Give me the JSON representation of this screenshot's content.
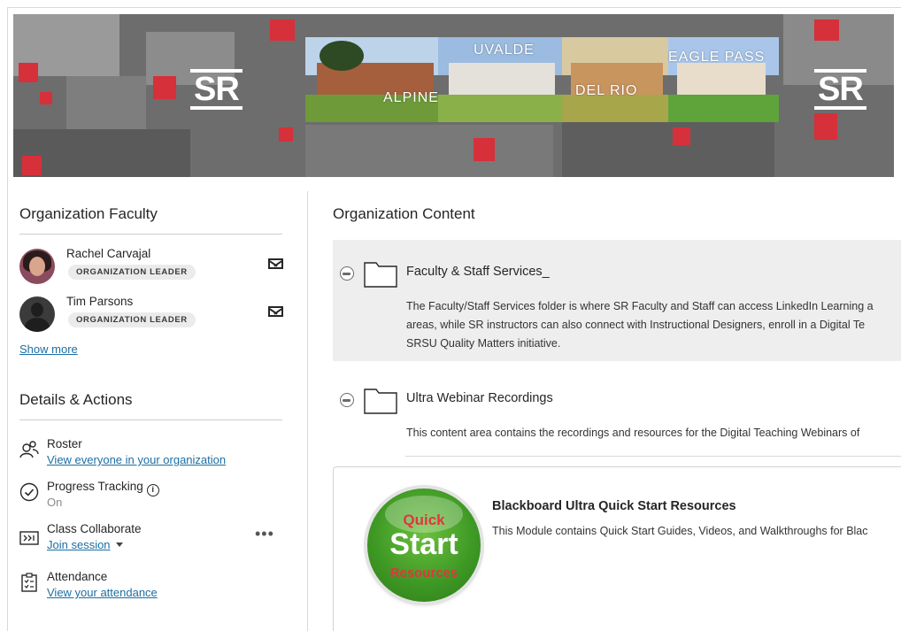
{
  "banner": {
    "logo_left": "SR",
    "logo_right": "SR",
    "campuses": [
      "ALPINE",
      "UVALDE",
      "DEL RIO",
      "EAGLE PASS"
    ],
    "accent": "#d6303a"
  },
  "faculty": {
    "title": "Organization Faculty",
    "members": [
      {
        "name": "Rachel Carvajal",
        "role": "ORGANIZATION LEADER"
      },
      {
        "name": "Tim Parsons",
        "role": "ORGANIZATION LEADER"
      }
    ],
    "show_more": "Show more"
  },
  "details": {
    "title": "Details & Actions",
    "items": [
      {
        "icon": "roster-icon",
        "title": "Roster",
        "sub": "View everyone in your organization"
      },
      {
        "icon": "progress-check-icon",
        "title": "Progress Tracking",
        "sub": "On",
        "info": "i"
      },
      {
        "icon": "collaborate-icon",
        "title": "Class Collaborate",
        "sub": "Join session",
        "more": "•••"
      },
      {
        "icon": "attendance-icon",
        "title": "Attendance",
        "sub": "View your attendance"
      }
    ]
  },
  "content": {
    "title": "Organization Content",
    "items": [
      {
        "title": "Faculty & Staff Services_",
        "desc": [
          "The Faculty/Staff Services folder is where SR Faculty and Staff can access LinkedIn Learning a",
          "areas, while SR instructors can also connect with Instructional Designers, enroll in a Digital Te",
          "SRSU Quality Matters initiative."
        ]
      },
      {
        "title": "Ultra Webinar Recordings",
        "desc": [
          "This content area contains the recordings and resources for the Digital Teaching Webinars of"
        ]
      }
    ],
    "module": {
      "badge_top": "Quick",
      "badge_mid": "Start",
      "badge_bottom": "Resources",
      "title": "Blackboard Ultra Quick Start Resources",
      "desc": "This Module contains Quick Start Guides, Videos, and Walkthroughs for Blac"
    }
  }
}
